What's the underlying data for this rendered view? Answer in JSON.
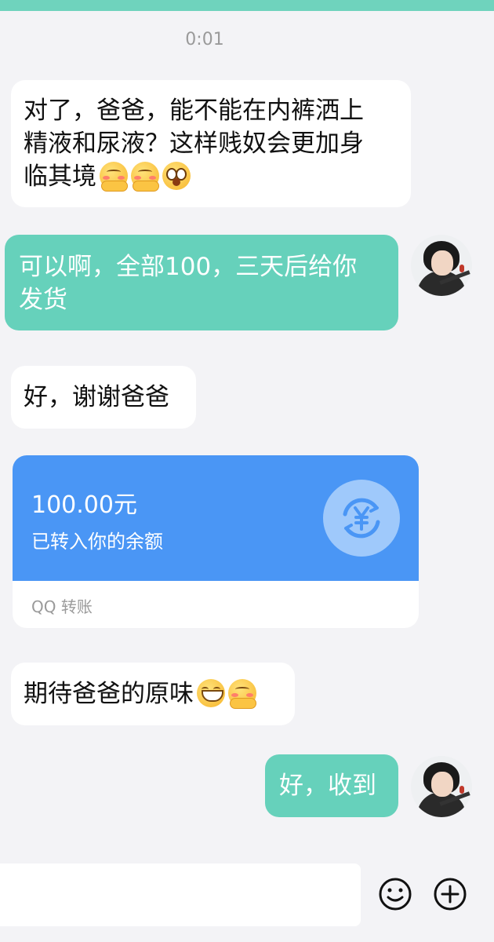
{
  "status_bar": {
    "accent": "#6fd3bd"
  },
  "chat": {
    "timestamp": "0:01",
    "messages": [
      {
        "side": "in",
        "lines": [
          "对了，爸爸，能不能在内裤洒上",
          "精液和尿液？这样贱奴会更加身",
          "临其境"
        ],
        "emojis": [
          "blush-hands-emoji",
          "blush-hands-emoji",
          "shocked-emoji"
        ]
      },
      {
        "side": "out",
        "lines": [
          "可以啊，全部100，三天后给你",
          "发货"
        ]
      },
      {
        "side": "in",
        "text": "好，谢谢爸爸"
      },
      {
        "side": "in",
        "text": "期待爸爸的原味",
        "emojis": [
          "grin-emoji",
          "blush-hands-emoji"
        ]
      },
      {
        "side": "out",
        "text": "好，收到"
      }
    ],
    "transfer": {
      "amount": "100.00元",
      "status": "已转入你的余额",
      "label": "QQ 转账",
      "color": "#4a96f5",
      "icon": "yuan-exchange-icon"
    }
  },
  "input_bar": {
    "emoji_icon": "smiley-icon",
    "plus_icon": "plus-circle-icon"
  },
  "colors": {
    "outgoing_bubble": "#66d1bb",
    "incoming_bubble": "#ffffff",
    "background": "#f3f3f6"
  }
}
